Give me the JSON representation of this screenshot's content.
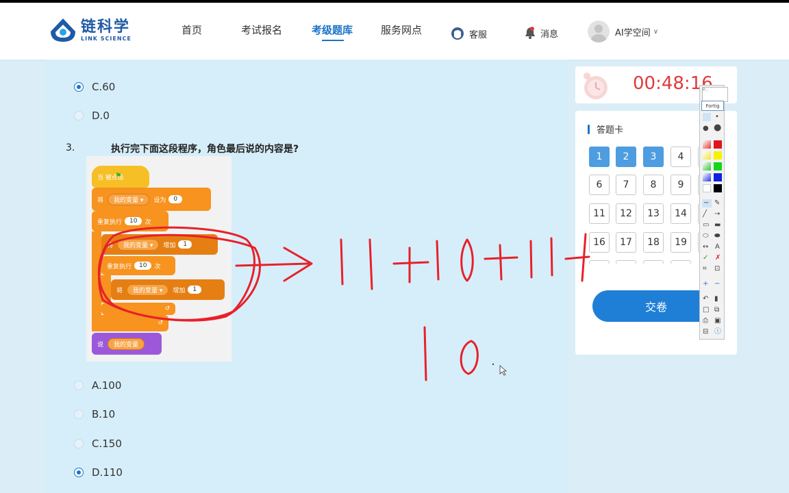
{
  "brand": {
    "name_cn": "链科学",
    "name_en": "LINK SCIENCE"
  },
  "nav": {
    "items": [
      "首页",
      "考试报名",
      "考级题库",
      "服务网点"
    ],
    "active": "考级题库",
    "service": "客服",
    "messages": "消息",
    "user": "AI学空间"
  },
  "question_prev": {
    "options": [
      {
        "label": "C.60",
        "checked": true
      },
      {
        "label": "D.0",
        "checked": false
      }
    ]
  },
  "question": {
    "number": "3.",
    "text": "执行完下面这段程序，角色最后说的内容是?",
    "options": [
      {
        "label": "A.100",
        "checked": false
      },
      {
        "label": "B.10",
        "checked": false
      },
      {
        "label": "C.150",
        "checked": false
      },
      {
        "label": "D.110",
        "checked": true
      }
    ]
  },
  "code_blocks": {
    "when_flag": "当  被点击",
    "set_prefix": "将",
    "var_name": "我的变量 ▾",
    "set_to": "设为",
    "set_value": "0",
    "repeat": "重复执行",
    "repeat_outer_count": "10",
    "repeat_suffix": "次",
    "change_prefix": "将",
    "change_by": "增加",
    "change_value": "1",
    "repeat_inner_count": "10",
    "say": "说",
    "say_var": "我的变量"
  },
  "timer": {
    "value": "00:48:16"
  },
  "answer_card": {
    "title": "答题卡",
    "rows": [
      [
        "1",
        "2",
        "3",
        "4"
      ],
      [
        "6",
        "7",
        "8",
        "9"
      ],
      [
        "11",
        "12",
        "13",
        "14"
      ],
      [
        "16",
        "17",
        "18",
        "19"
      ]
    ],
    "answered": [
      "1",
      "2",
      "3"
    ],
    "submit_label": "交卷"
  },
  "annotation_toolbar": {
    "top_label": "P...",
    "mode_label": "Fortig"
  },
  "colors": {
    "accent": "#1a73c9",
    "timer": "#e03a3a",
    "ink": "#e8202a",
    "answered_cell": "#4d9de0"
  }
}
